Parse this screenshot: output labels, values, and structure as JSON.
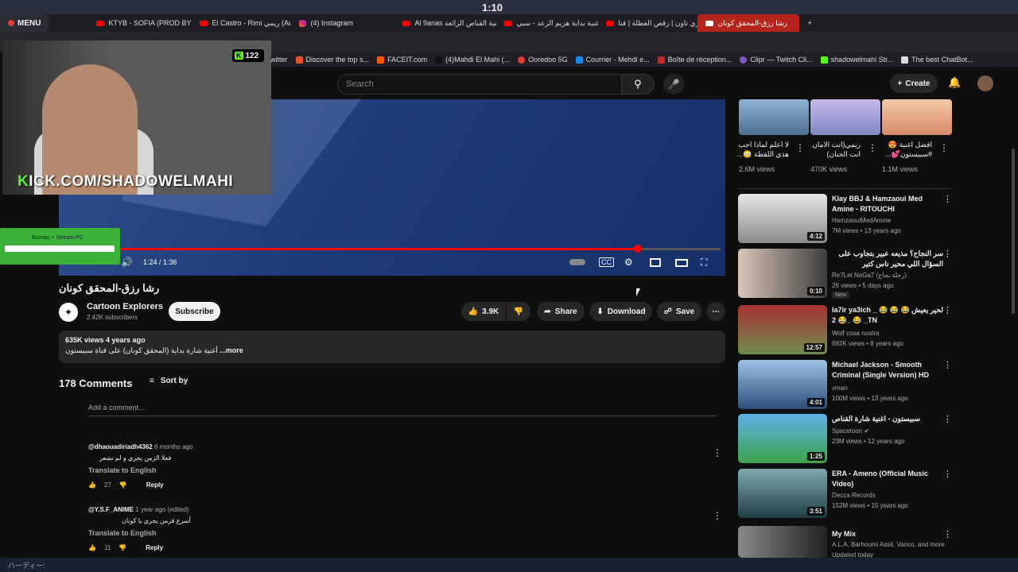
{
  "os": {
    "clock": "1:10",
    "taskbar_text": "ハーディー:"
  },
  "browser": {
    "menu_label": "MENU",
    "tabs": [
      {
        "label": "KTYB - SOFIA (PROD BY",
        "icon": "youtube-icon"
      },
      {
        "label": "El Castro - Rimi ريمي (Au",
        "icon": "youtube-icon"
      },
      {
        "label": "(4) Instagram",
        "icon": "instagram-icon"
      },
      {
        "label": "Al 9anas أغنية القناص الرائعة",
        "icon": "youtube-icon"
      },
      {
        "label": "أغنية بداية هزيم الرعد - سبي",
        "icon": "youtube-icon"
      },
      {
        "label": "ليزي تاون | رقص العطلة | قنا",
        "icon": "youtube-icon"
      },
      {
        "label": "رشا رزق-المحقق كونان",
        "icon": "youtube-icon",
        "active": true
      }
    ],
    "new_tab": "+",
    "bookmarks": [
      {
        "label": "witter"
      },
      {
        "label": "Discover the top s..."
      },
      {
        "label": "FACEIT.com"
      },
      {
        "label": "(4)Mahdi El Mahi (..."
      },
      {
        "label": "Ooredoo 5G"
      },
      {
        "label": "Courrier - Mehdi e..."
      },
      {
        "label": "Boîte de réception..."
      },
      {
        "label": "Clipr — Twitch Cli..."
      },
      {
        "label": "shadowelmahi Str..."
      },
      {
        "label": "The best ChatBot..."
      }
    ]
  },
  "yt": {
    "search_placeholder": "Search",
    "create_label": "Create",
    "video": {
      "title": "رشا رزق-المحقق كونان",
      "time": "1:24 / 1:36",
      "progress_fraction": 0.875,
      "channel": "Cartoon Explorers",
      "subscribers": "2.42K subscribers",
      "subscribe_label": "Subscribe",
      "likes": "3.9K",
      "share_label": "Share",
      "download_label": "Download",
      "save_label": "Save",
      "views_age": "635K views  4 years ago",
      "description": "أغنية شارة بداية (المحقق كونان) على قناة سبيستون",
      "more_label": "...more"
    },
    "comments": {
      "count": "178 Comments",
      "sort_label": "Sort by",
      "add_placeholder": "Add a comment...",
      "items": [
        {
          "author": "@dhaouadiriadh4362",
          "date": "6 months ago",
          "text": "فعلا الزمن يجري و لم نشعر",
          "translate": "Translate to English",
          "likes": "27",
          "reply": "Reply"
        },
        {
          "author": "@Y.S.F_ANIME",
          "date": "1 year ago (edited)",
          "text": "أسرع فزمن يجري يا كونان",
          "translate": "Translate to English",
          "likes": "11",
          "reply": "Reply"
        }
      ]
    }
  },
  "overlay": {
    "kick_count": "122",
    "kick_url_k": "K",
    "kick_url_rest": "ICK.COM/SHADOWELMAHI",
    "stream_label": "Bureau + Stream PC"
  },
  "shorts": [
    {
      "title": "لا اعلم لماذا احب هذي اللقطة 😳...",
      "views": "2.6M views"
    },
    {
      "title": "ريمي(انت الامان انت الحنان)",
      "views": "470K views"
    },
    {
      "title": "افضل اغنية 😍 #سبيستون💕...",
      "views": "1.1M views"
    }
  ],
  "sidebar_videos": [
    {
      "title": "Klay BBJ & Hamzaoui Med Amine -  RITOUCHI",
      "channel": "HamzaouiMedAmine",
      "meta": "7M views • 13 years ago",
      "duration": "4:12"
    },
    {
      "title": "سر النجاح؟ مذيعه عبير بتجاوب على السؤال اللي محير ناس كتير",
      "channel": "Re7Let NaGa7 (رحلة نجاح)",
      "meta": "26 views • 5 days ago",
      "duration": "0:10",
      "badge": "New"
    },
    {
      "title": "la7ir ya3ich _ لحير يعيش 😂 😂 😂 😂 2_ 😂 _TN",
      "channel": "Wolf cosa nostra",
      "meta": "682K views • 8 years ago",
      "duration": "12:57"
    },
    {
      "title": "Michael Jackson - Smooth Criminal (Single Version) HD",
      "channel": "vman",
      "meta": "100M views • 13 years ago",
      "duration": "4:01"
    },
    {
      "title": "سبيستون - اغنية شارة القناص",
      "channel": "Spacetoon ✔",
      "meta": "23M views • 12 years ago",
      "duration": "1:25"
    },
    {
      "title": "ERA - Ameno (Official Music Video)",
      "channel": "Decca Records",
      "meta": "152M views • 15 years ago",
      "duration": "3:51"
    },
    {
      "title": "My Mix",
      "channel": "A.L.A, Barhoumi Assil, Vanco, and more",
      "meta": "Updated today",
      "duration": ""
    }
  ]
}
